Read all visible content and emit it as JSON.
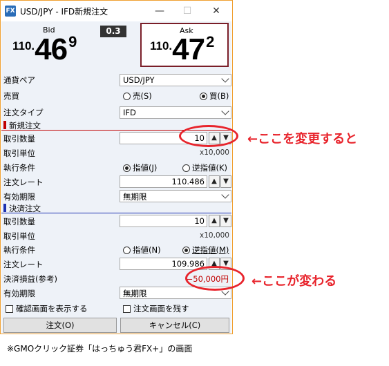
{
  "window": {
    "title": "USD/JPY - IFD新規注文",
    "icon_label": "FX",
    "minimize": "—",
    "maximize": "☐",
    "close": "✕"
  },
  "quote": {
    "bid_label": "Bid",
    "bid_small": "110.",
    "bid_big": "46",
    "bid_sup": "9",
    "spread": "0.3",
    "ask_label": "Ask",
    "ask_small": "110.",
    "ask_big": "47",
    "ask_sup": "2"
  },
  "form": {
    "pair_label": "通貨ペア",
    "pair_value": "USD/JPY",
    "side_label": "売買",
    "sell_label": "売(S)",
    "buy_label": "買(B)",
    "order_type_label": "注文タイプ",
    "order_type_value": "IFD"
  },
  "new_order": {
    "section_title": "新規注文",
    "qty_label": "取引数量",
    "qty_value": "10",
    "unit_label": "取引単位",
    "unit_value": "x10,000",
    "exec_label": "執行条件",
    "limit_label": "指値(J)",
    "stop_label": "逆指値(K)",
    "rate_label": "注文レート",
    "rate_value": "110.486",
    "expiry_label": "有効期限",
    "expiry_value": "無期限"
  },
  "settle_order": {
    "section_title": "決済注文",
    "qty_label": "取引数量",
    "qty_value": "10",
    "unit_label": "取引単位",
    "unit_value": "x10,000",
    "exec_label": "執行条件",
    "limit_label": "指値(N)",
    "stop_label": "逆指値(M)",
    "rate_label": "注文レート",
    "rate_value": "109.986",
    "pl_label": "決済損益(参考)",
    "pl_value": "−50,000円",
    "expiry_label": "有効期限",
    "expiry_value": "無期限"
  },
  "options": {
    "confirm_label": "確認画面を表示する",
    "keep_label": "注文画面を残す"
  },
  "buttons": {
    "order": "注文(O)",
    "cancel": "キャンセル(C)"
  },
  "steppers": {
    "up": "▲",
    "down": "▼"
  },
  "annotations": {
    "change_here": "←ここを変更すると",
    "changes_here": "←ここが変わる"
  },
  "caption": "※GMOクリック証券「はっちゅう君FX+」の画面",
  "colors": {
    "new_order_accent": "#c00000",
    "settle_order_accent": "#1a2fb0",
    "annotation_red": "#e8242c",
    "ask_border": "#7a1e28",
    "window_border": "#f0a030"
  }
}
